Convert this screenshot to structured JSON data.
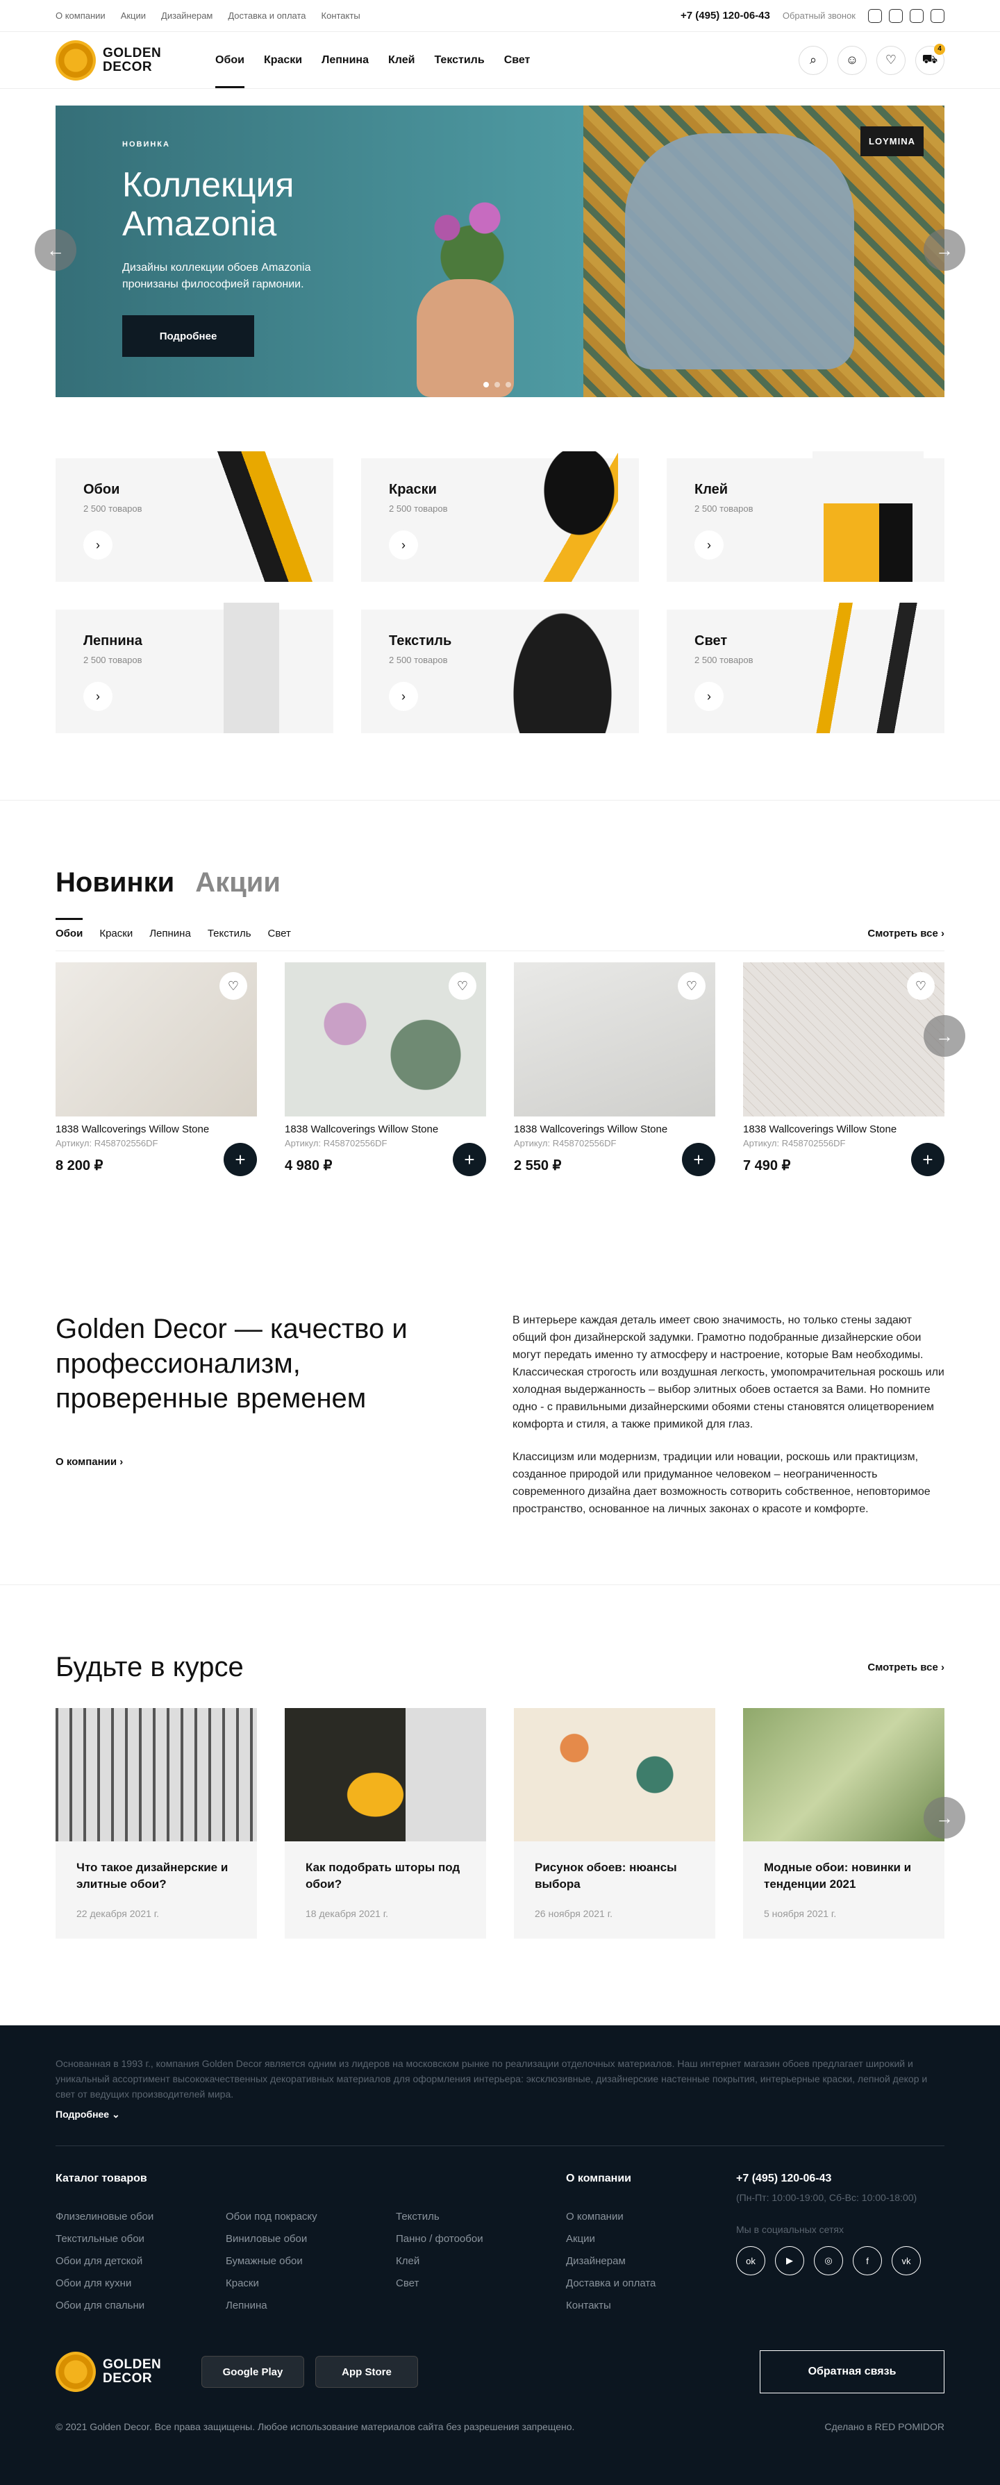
{
  "topbar": {
    "links": [
      "О компании",
      "Акции",
      "Дизайнерам",
      "Доставка и оплата",
      "Контакты"
    ],
    "phone": "+7 (495) 120-06-43",
    "callback": "Обратный звонок"
  },
  "header": {
    "logo_line1": "GOLDEN",
    "logo_line2": "DECOR",
    "nav": [
      "Обои",
      "Краски",
      "Лепнина",
      "Клей",
      "Текстиль",
      "Свет"
    ],
    "cart_count": "4"
  },
  "hero": {
    "tag": "НОВИНКА",
    "title": "Коллекция Amazonia",
    "text": "Дизайны коллекции обоев Amazonia пронизаны философией гармонии.",
    "button": "Подробнее",
    "brand": "LOYMINA"
  },
  "categories": [
    {
      "name": "Обои",
      "count": "2 500 товаров"
    },
    {
      "name": "Краски",
      "count": "2 500 товаров"
    },
    {
      "name": "Клей",
      "count": "2 500 товаров"
    },
    {
      "name": "Лепнина",
      "count": "2 500 товаров"
    },
    {
      "name": "Текстиль",
      "count": "2 500 товаров"
    },
    {
      "name": "Свет",
      "count": "2 500 товаров"
    }
  ],
  "new": {
    "title_active": "Новинки",
    "title_other": "Акции",
    "tabs": [
      "Обои",
      "Краски",
      "Лепнина",
      "Текстиль",
      "Свет"
    ],
    "see_all": "Смотреть все"
  },
  "products": [
    {
      "name": "1838 Wallcoverings Willow Stone",
      "article": "Артикул: R458702556DF",
      "price": "8 200 ₽"
    },
    {
      "name": "1838 Wallcoverings Willow Stone",
      "article": "Артикул: R458702556DF",
      "price": "4 980 ₽"
    },
    {
      "name": "1838 Wallcoverings Willow Stone",
      "article": "Артикул: R458702556DF",
      "price": "2 550 ₽"
    },
    {
      "name": "1838 Wallcoverings Willow Stone",
      "article": "Артикул: R458702556DF",
      "price": "7 490 ₽"
    }
  ],
  "about": {
    "title": "Golden Decor — качество и профессионализм, проверенные временем",
    "link": "О компании",
    "p1": "В интерьере каждая деталь имеет свою значимость, но только стены задают общий фон дизайнерской задумки. Грамотно подобранные дизайнерские обои могут передать именно ту атмосферу и настроение, которые Вам необходимы. Классическая строгость или воздушная легкость, умопомрачительная роскошь или холодная выдержанность – выбор элитных обоев остается за Вами. Но помните одно - с правильными дизайнерскими обоями стены становятся олицетворением комфорта и стиля, а также примикой для глаз.",
    "p2": "Классицизм или модернизм, традиции или новации, роскошь или практицизм, созданное природой или придуманное человеком – неограниченность современного дизайна дает возможность сотворить собственное, неповторимое пространство, основанное на личных законах о красоте и комфорте."
  },
  "blog": {
    "title": "Будьте в курсе",
    "see_all": "Смотреть все",
    "posts": [
      {
        "title": "Что такое дизайнерские и элитные обои?",
        "date": "22 декабря 2021 г."
      },
      {
        "title": "Как подобрать шторы под обои?",
        "date": "18 декабря 2021 г."
      },
      {
        "title": "Рисунок обоев: нюансы выбора",
        "date": "26 ноября 2021 г."
      },
      {
        "title": "Модные обои: новинки и тенденции 2021",
        "date": "5 ноября 2021 г."
      }
    ]
  },
  "footer": {
    "info": "Основанная в 1993 г., компания Golden Decor является одним из лидеров на московском рынке по реализации отделочных материалов. Наш интернет магазин обоев предлагает широкий и уникальный ассортимент высококачественных декоративных материалов для оформления интерьера: эксклюзивные, дизайнерские настенные покрытия, интерьерные краски, лепной декор и свет от ведущих производителей мира.",
    "more": "Подробнее",
    "catalog_title": "Каталог товаров",
    "catalog": [
      "Флизелиновые обои",
      "Обои под покраску",
      "Текстиль",
      "Текстильные обои",
      "Виниловые обои",
      "Панно / фотообои",
      "Обои для детской",
      "Бумажные обои",
      "Клей",
      "Обои для кухни",
      "Краски",
      "Свет",
      "Обои для спальни",
      "Лепнина",
      ""
    ],
    "company_title": "О компании",
    "company": [
      "О компании",
      "Акции",
      "Дизайнерам",
      "Доставка и оплата",
      "Контакты"
    ],
    "phone": "+7 (495) 120-06-43",
    "hours": "(Пн-Пт: 10:00-19:00, Сб-Вс: 10:00-18:00)",
    "social_label": "Мы в социальных сетях",
    "google": "Google Play",
    "apple": "App Store",
    "callback": "Обратная связь",
    "copyright": "© 2021 Golden Decor. Все права защищены. Любое использование материалов сайта без разрешения запрещено.",
    "made": "Сделано в RED POMIDOR"
  }
}
